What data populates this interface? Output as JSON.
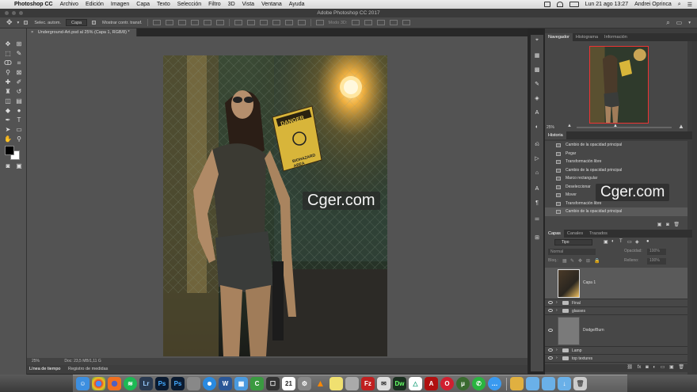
{
  "menubar": {
    "app": "Photoshop CC",
    "items": [
      "Archivo",
      "Edición",
      "Imagen",
      "Capa",
      "Texto",
      "Selección",
      "Filtro",
      "3D",
      "Vista",
      "Ventana",
      "Ayuda"
    ],
    "clock": "Lun 21 ago  13:27",
    "user": "Andrei Oprinca"
  },
  "window": {
    "title": "Adobe Photoshop CC 2017"
  },
  "options": {
    "auto_select_label": "Selec. autom.",
    "auto_select_value": "Capa",
    "transform_label": "Mostrar contr. transf.",
    "mode3d_label": "Modo 3D:"
  },
  "document": {
    "tab": "Underground-Art.psd al 25% (Capa 1, RGB/8) *",
    "zoom": "25%",
    "doc_info": "Doc: 23,5 MB/1,11 G"
  },
  "timeline": {
    "tab1": "Línea de tiempo",
    "tab2": "Registro de medidas"
  },
  "navigator": {
    "tabs": [
      "Navegador",
      "Histograma",
      "Información"
    ],
    "zoom": "25%"
  },
  "history": {
    "title": "Historia",
    "items": [
      "Cambio de la opacidad principal",
      "Pegar",
      "Transformación libre",
      "Cambio de la opacidad principal",
      "Marco rectangular",
      "Deseleccionar",
      "Mover",
      "Transformación libre",
      "Cambio de la opacidad principal"
    ]
  },
  "layers": {
    "tabs": [
      "Capas",
      "Canales",
      "Trazados"
    ],
    "filter": "Tipo",
    "blend": "Normal",
    "opacity_label": "Opacidad:",
    "opacity": "100%",
    "lock_label": "Bloq.:",
    "fill_label": "Relleno:",
    "fill": "100%",
    "items": [
      "Capa 1",
      "Final",
      "glasses",
      "Dodge/Burn",
      "Lamp",
      "top textures"
    ]
  },
  "watermark": "Cger.com",
  "art": {
    "sign_top": "DANGER",
    "sign_bottom": "BIOHAZARD\nAREA"
  },
  "dock": {
    "apps": [
      "Finder",
      "Chrome",
      "Firefox",
      "Spotify",
      "Lightroom",
      "Photoshop",
      "Photoshop",
      "App",
      "Safari",
      "Word",
      "Calendar",
      "Camtasia",
      "Illustrator",
      "Calendar",
      "Preferences",
      "VLC",
      "Notes",
      "Screen",
      "FileZilla",
      "Mail",
      "Dreamweaver",
      "Drive",
      "Acrobat",
      "Opera",
      "Torrent",
      "WhatsApp",
      "Messages",
      "Folder",
      "Folder",
      "Folder",
      "Downloads",
      "Trash"
    ],
    "calendar_day": "21"
  }
}
